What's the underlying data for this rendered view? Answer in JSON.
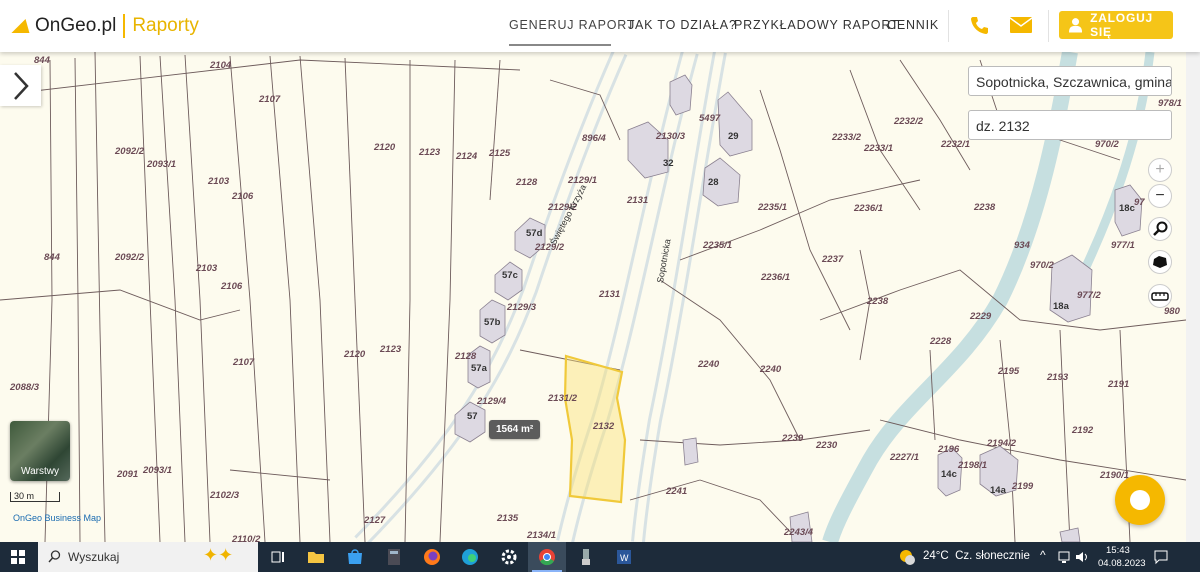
{
  "header": {
    "brand": "OnGeo.pl",
    "brand_sub": "Raporty",
    "nav": [
      "GENERUJ RAPORT",
      "JAK TO DZIAŁA?",
      "PRZYKŁADOWY RAPORT",
      "CENNIK"
    ],
    "login_label": "ZALOGUJ SIĘ",
    "accent": "#f5c518"
  },
  "search": {
    "location": "Sopotnicka, Szczawnica, gmina",
    "parcel": "dz. 2132"
  },
  "map": {
    "area_badge": "1564 m²",
    "layers_label": "Warstwy",
    "scale_label": "30 m",
    "attribution": "OnGeo Business Map",
    "highlight_color": "#f0c93a",
    "street_labels": [
      "Świętego Krzyża",
      "Sopotnicka"
    ],
    "parcel_labels": {
      "p844a": "844",
      "p844b": "844",
      "p2104": "2104",
      "p2107a": "2107",
      "p2092_2a": "2092/2",
      "p2093_1a": "2093/1",
      "p2103a": "2103",
      "p2106a": "2106",
      "p2120a": "2120",
      "p2123a": "2123",
      "p2124": "2124",
      "p2125": "2125",
      "p896_4": "896/4",
      "p2130_3": "2130/3",
      "p5497": "5497",
      "p2128a": "2128",
      "p2129_1": "2129/1",
      "p2129_2a": "2129/2",
      "p2129_2b": "2129/2",
      "p2131a": "2131",
      "p2131b": "2131",
      "p2129_3": "2129/3",
      "p2092_2b": "2092/2",
      "p2103b": "2103",
      "p2106b": "2106",
      "p2107b": "2107",
      "p2120b": "2120",
      "p2123b": "2123",
      "p2128b": "2128",
      "p2129_4": "2129/4",
      "p2131_2": "2131/2",
      "p2132": "2132",
      "p2088_3": "2088/3",
      "p2091": "2091",
      "p2093_1b": "2093/1",
      "p2102_3": "2102/3",
      "p2110_2": "2110/2",
      "p2127": "2127",
      "p2135": "2135",
      "p2134_1": "2134/1",
      "p2241": "2241",
      "p2240a": "2240",
      "p2240b": "2240",
      "p2239": "2239",
      "p2230": "2230",
      "p2243_4": "2243/4",
      "p2235_1a": "2235/1",
      "p2235_1b": "2235/1",
      "p2236_1a": "2236/1",
      "p2236_1b": "2236/1",
      "p2237": "2237",
      "p2238a": "2238",
      "p2238b": "2238",
      "p2233_2": "2233/2",
      "p2233_1": "2233/1",
      "p2232_2": "2232/2",
      "p2232_1": "2232/1",
      "p2229": "2229",
      "p2228": "2228",
      "p2195": "2195",
      "p2193": "2193",
      "p2191": "2191",
      "p2192": "2192",
      "p2227_1": "2227/1",
      "p2196": "2196",
      "p2194_2": "2194/2",
      "p2198_1": "2198/1",
      "p2199": "2199",
      "p2190_1": "2190/1",
      "p934": "934",
      "p970_2a": "970/2",
      "p970_2b": "970/2",
      "p977_2": "977/2",
      "p977_1": "977/1",
      "p978_1": "978/1",
      "p980": "980",
      "p97x": "97"
    },
    "building_labels": {
      "b57d": "57d",
      "b57c": "57c",
      "b57b": "57b",
      "b57a": "57a",
      "b57": "57",
      "b32": "32",
      "b29": "29",
      "b28": "28",
      "b18c": "18c",
      "b18a": "18a",
      "b14c": "14c",
      "b14a": "14a"
    },
    "controls": [
      "zoom-in-icon",
      "zoom-out-icon",
      "search-icon",
      "polygon-icon",
      "measure-icon"
    ]
  },
  "taskbar": {
    "search_placeholder": "Wyszukaj",
    "weather": "24°C  Cz. słonecznie",
    "time": "15:43",
    "date": "04.08.2023"
  }
}
